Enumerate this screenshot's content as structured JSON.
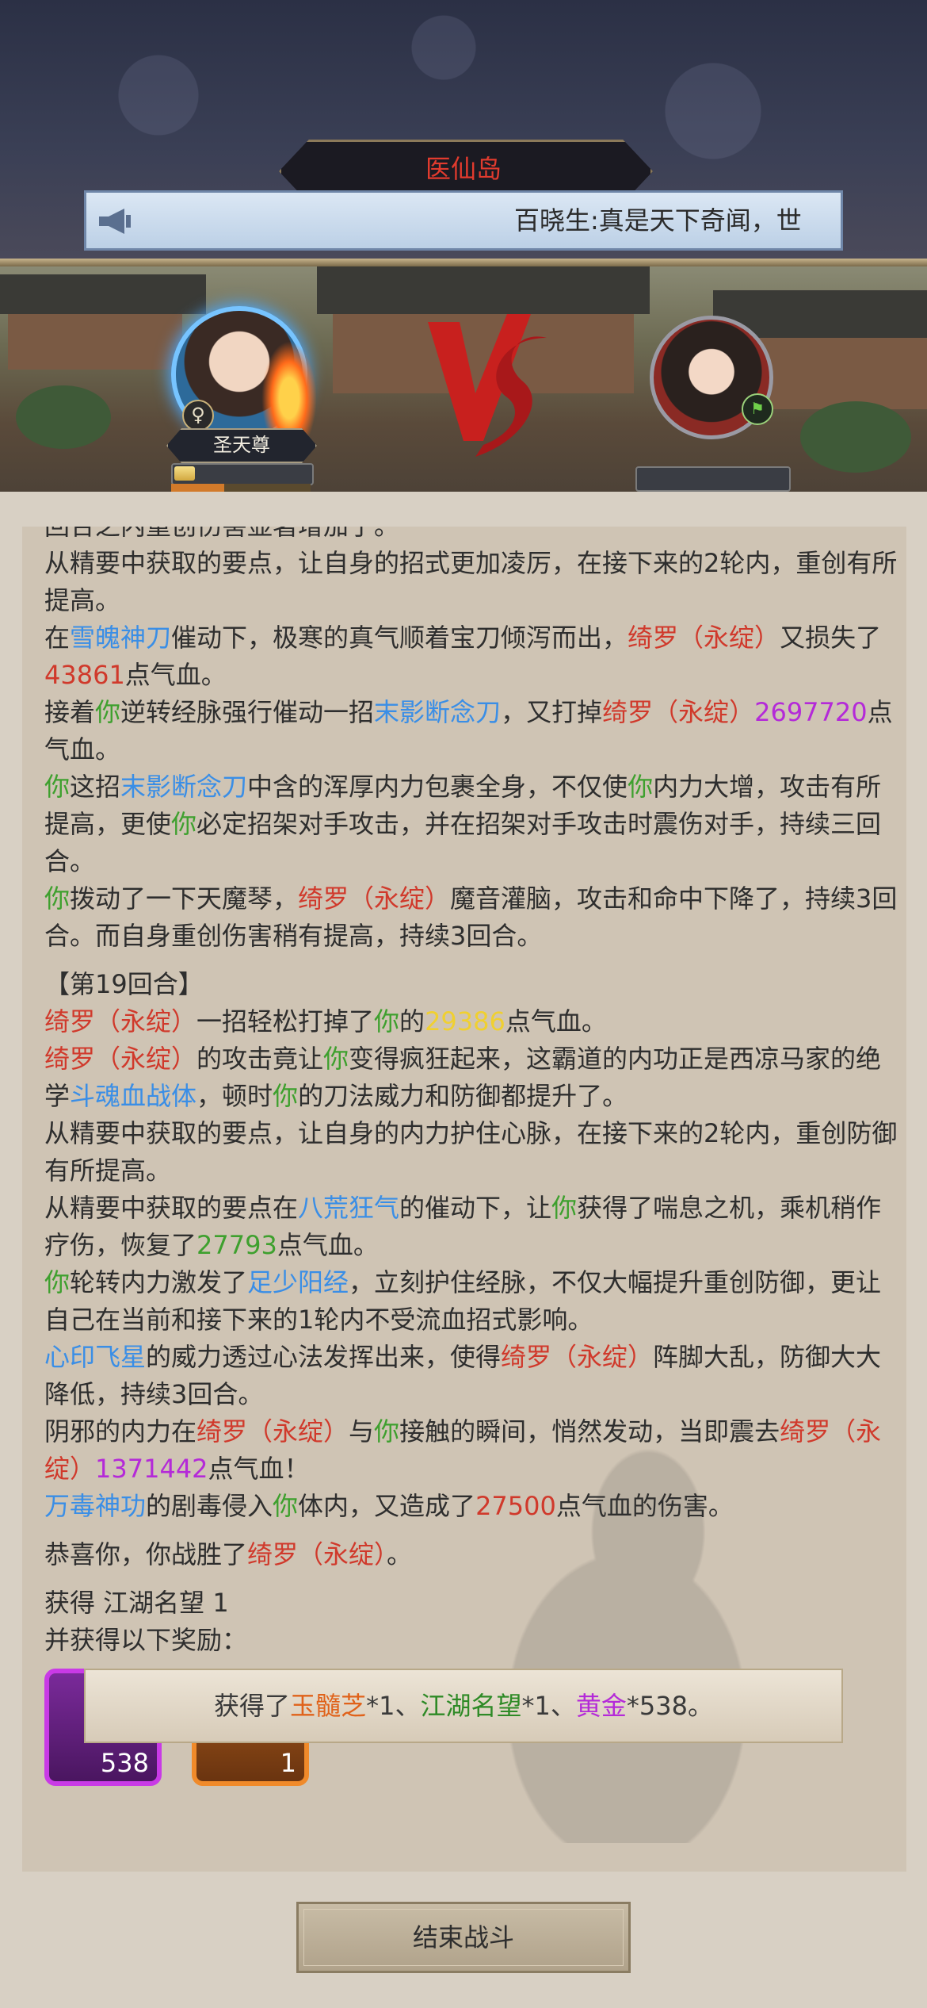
{
  "header": {
    "location": "医仙岛",
    "bulletin": "百晓生:真是天下奇闻，世"
  },
  "battle": {
    "player_name": "圣天尊",
    "player_gender_icon": "female-icon",
    "enemy_class_icon": "boot-icon",
    "player_hp_fraction": 0.15,
    "player_mp_fraction": 0.38
  },
  "log": [
    {
      "segs": [
        {
          "t": "回合之内重创伤害显著增加了。",
          "c": ""
        }
      ],
      "cut": true
    },
    {
      "segs": [
        {
          "t": "从精要中获取的要点，让自身的招式更加凌厉，在接下来的2轮内，重创有所提高。",
          "c": ""
        }
      ]
    },
    {
      "segs": [
        {
          "t": "在",
          "c": ""
        },
        {
          "t": "雪魄神刀",
          "c": "blue"
        },
        {
          "t": "催动下，极寒的真气顺着宝刀倾泻而出，",
          "c": ""
        },
        {
          "t": "绮罗（永绽）",
          "c": "red"
        },
        {
          "t": "又损失了",
          "c": ""
        },
        {
          "t": "43861",
          "c": "red"
        },
        {
          "t": "点气血。",
          "c": ""
        }
      ]
    },
    {
      "segs": [
        {
          "t": "接着",
          "c": ""
        },
        {
          "t": "你",
          "c": "green"
        },
        {
          "t": "逆转经脉强行催动一招",
          "c": ""
        },
        {
          "t": "末影断念刀",
          "c": "blue"
        },
        {
          "t": "，又打掉",
          "c": ""
        },
        {
          "t": "绮罗（永绽）",
          "c": "red"
        },
        {
          "t": "2697720",
          "c": "purple"
        },
        {
          "t": "点气血。",
          "c": ""
        }
      ]
    },
    {
      "segs": [
        {
          "t": "你",
          "c": "green"
        },
        {
          "t": "这招",
          "c": ""
        },
        {
          "t": "末影断念刀",
          "c": "blue"
        },
        {
          "t": "中含的浑厚内力包裹全身，不仅使",
          "c": ""
        },
        {
          "t": "你",
          "c": "green"
        },
        {
          "t": "内力大增，攻击有所提高，更使",
          "c": ""
        },
        {
          "t": "你",
          "c": "green"
        },
        {
          "t": "必定招架对手攻击，并在招架对手攻击时震伤对手，持续三回合。",
          "c": ""
        }
      ]
    },
    {
      "segs": [
        {
          "t": "你",
          "c": "green"
        },
        {
          "t": "拨动了一下天魔琴，",
          "c": ""
        },
        {
          "t": "绮罗（永绽）",
          "c": "red"
        },
        {
          "t": "魔音灌脑，攻击和命中下降了，持续3回合。而自身重创伤害稍有提高，持续3回合。",
          "c": ""
        }
      ]
    },
    {
      "round": "【第19回合】"
    },
    {
      "segs": [
        {
          "t": "绮罗（永绽）",
          "c": "red"
        },
        {
          "t": "一招轻松打掉了",
          "c": ""
        },
        {
          "t": "你",
          "c": "green"
        },
        {
          "t": "的",
          "c": ""
        },
        {
          "t": "29386",
          "c": "yellow"
        },
        {
          "t": "点气血。",
          "c": ""
        }
      ]
    },
    {
      "segs": [
        {
          "t": "绮罗（永绽）",
          "c": "red"
        },
        {
          "t": "的攻击竟让",
          "c": ""
        },
        {
          "t": "你",
          "c": "green"
        },
        {
          "t": "变得疯狂起来，这霸道的内功正是西凉马家的绝学",
          "c": ""
        },
        {
          "t": "斗魂血战体",
          "c": "blue"
        },
        {
          "t": "，顿时",
          "c": ""
        },
        {
          "t": "你",
          "c": "green"
        },
        {
          "t": "的刀法威力和防御都提升了。",
          "c": ""
        }
      ]
    },
    {
      "segs": [
        {
          "t": "从精要中获取的要点，让自身的内力护住心脉，在接下来的2轮内，重创防御有所提高。",
          "c": ""
        }
      ]
    },
    {
      "segs": [
        {
          "t": "从精要中获取的要点在",
          "c": ""
        },
        {
          "t": "八荒狂气",
          "c": "blue"
        },
        {
          "t": "的催动下，让",
          "c": ""
        },
        {
          "t": "你",
          "c": "green"
        },
        {
          "t": "获得了喘息之机，乘机稍作疗伤，恢复了",
          "c": ""
        },
        {
          "t": "27793",
          "c": "green"
        },
        {
          "t": "点气血。",
          "c": ""
        }
      ]
    },
    {
      "segs": [
        {
          "t": "你",
          "c": "green"
        },
        {
          "t": "轮转内力激发了",
          "c": ""
        },
        {
          "t": "足少阳经",
          "c": "blue"
        },
        {
          "t": "，立刻护住经脉，不仅大幅提升重创防御，更让自己在当前和接下来的1轮内不受流血招式影响。",
          "c": ""
        }
      ]
    },
    {
      "segs": [
        {
          "t": "心印飞星",
          "c": "blue"
        },
        {
          "t": "的威力透过心法发挥出来，使得",
          "c": ""
        },
        {
          "t": "绮罗（永绽）",
          "c": "red"
        },
        {
          "t": "阵脚大乱，防御大大降低，持续3回合。",
          "c": ""
        }
      ]
    },
    {
      "segs": [
        {
          "t": "阴邪的内力在",
          "c": ""
        },
        {
          "t": "绮罗（永绽）",
          "c": "red"
        },
        {
          "t": "与",
          "c": ""
        },
        {
          "t": "你",
          "c": "green"
        },
        {
          "t": "接触的瞬间，悄然发动，当即震去",
          "c": ""
        },
        {
          "t": "绮罗（永绽）",
          "c": "red"
        },
        {
          "t": "1371442",
          "c": "purple"
        },
        {
          "t": "点气血！",
          "c": ""
        }
      ]
    },
    {
      "segs": [
        {
          "t": "万毒神功",
          "c": "blue"
        },
        {
          "t": "的剧毒侵入",
          "c": ""
        },
        {
          "t": "你",
          "c": "green"
        },
        {
          "t": "体内，又造成了",
          "c": ""
        },
        {
          "t": "27500",
          "c": "red"
        },
        {
          "t": "点气血的伤害。",
          "c": ""
        }
      ]
    },
    {
      "segs": [
        {
          "t": "恭喜你，你战胜了",
          "c": ""
        },
        {
          "t": "绮罗（永绽）",
          "c": "red"
        },
        {
          "t": "。",
          "c": ""
        }
      ],
      "gap": true
    },
    {
      "segs": [
        {
          "t": "获得 江湖名望 1",
          "c": ""
        }
      ],
      "gap": true
    },
    {
      "segs": [
        {
          "t": "并获得以下奖励：",
          "c": ""
        }
      ]
    }
  ],
  "rewards": [
    {
      "count": "538",
      "rarity_color": "#c93ae6"
    },
    {
      "count": "1",
      "rarity_color": "#f08a2a"
    }
  ],
  "toast": {
    "prefix": "获得了",
    "item1": "玉髓芝",
    "item1_qty": "*1、",
    "item2": "江湖名望",
    "item2_qty": "*1、",
    "item3": "黄金",
    "item3_qty": "*538。"
  },
  "footer": {
    "end_button": "结束战斗"
  },
  "colors": {
    "red": "#d0392b",
    "green": "#3ea02e",
    "blue": "#3a8ee6",
    "purple": "#b42ad8",
    "yellow": "#f0d030",
    "orange": "#e0621a"
  }
}
